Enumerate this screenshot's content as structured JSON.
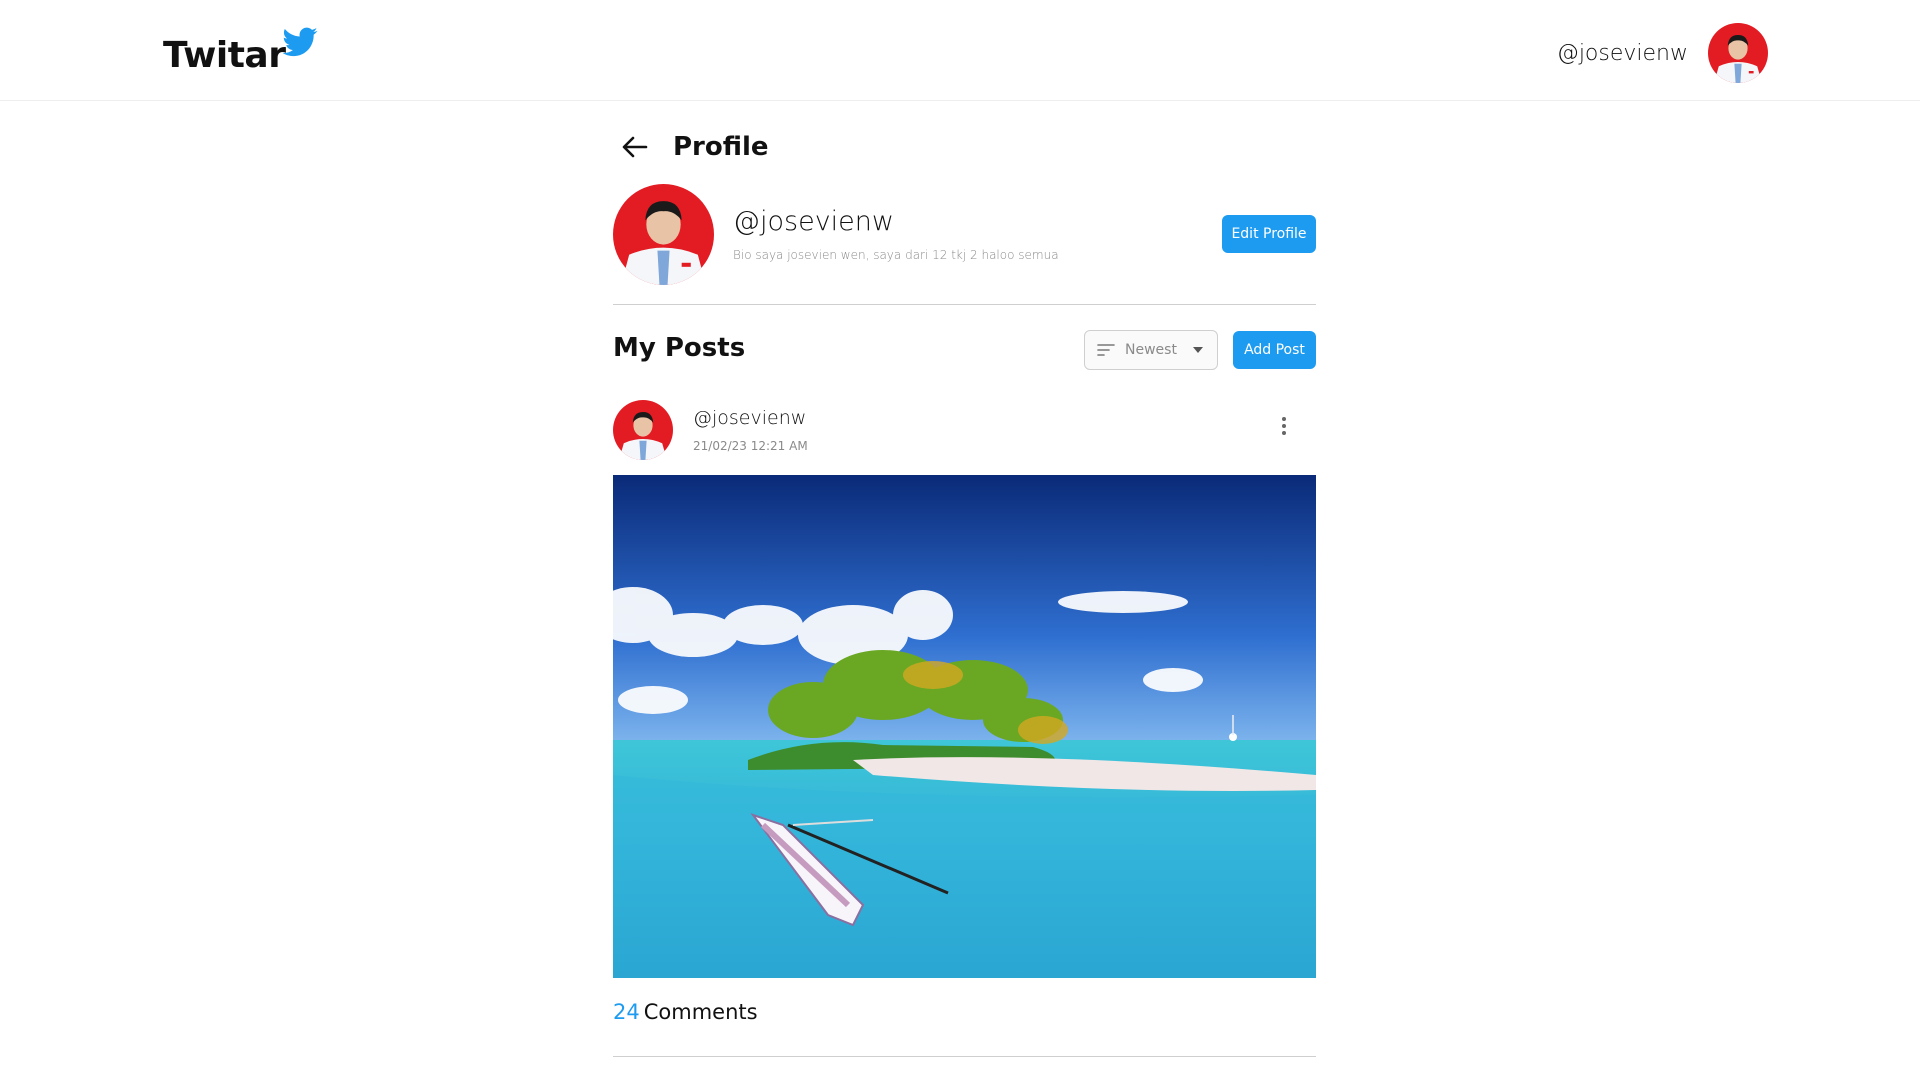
{
  "header": {
    "logo_text": "Twitar",
    "username": "@josevienw"
  },
  "page": {
    "title": "Profile"
  },
  "profile": {
    "username": "@josevienw",
    "bio": "Bio saya josevien wen, saya dari 12 tkj 2 haloo semua",
    "edit_label": "Edit Profile"
  },
  "posts": {
    "title": "My Posts",
    "sort_value": "Newest",
    "add_label": "Add Post",
    "items": [
      {
        "username": "@josevienw",
        "timestamp": "21/02/23 12:21 AM",
        "comment_count": "24",
        "comment_label": "Comments"
      }
    ]
  },
  "colors": {
    "accent": "#1d9bf0",
    "avatar_bg": "#e31b23"
  }
}
